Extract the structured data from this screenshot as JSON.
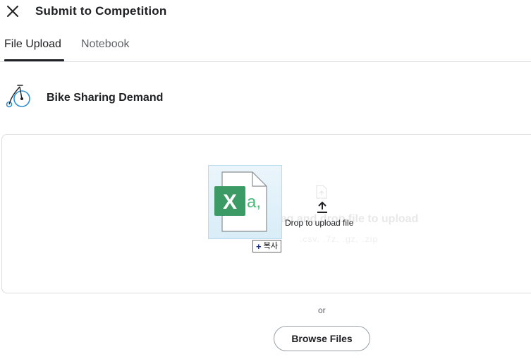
{
  "dialog": {
    "title": "Submit to Competition"
  },
  "tabs": [
    {
      "label": "File Upload",
      "active": true
    },
    {
      "label": "Notebook",
      "active": false
    }
  ],
  "competition": {
    "name": "Bike Sharing Demand",
    "icon": "penny-farthing-bicycle-icon"
  },
  "dropzone": {
    "ghost_text": "Drag and drop file to upload",
    "ghost_sub": ".csv, .7z, .gz, .zip",
    "drop_text": "Drop to upload file"
  },
  "drag_preview": {
    "file_icon": "excel-csv-file-icon",
    "copy_badge": "복사"
  },
  "or_text": "or",
  "browse_button": "Browse Files",
  "colors": {
    "accent": "#202124",
    "excel_green": "#3c9a64",
    "border": "#dadce0"
  }
}
